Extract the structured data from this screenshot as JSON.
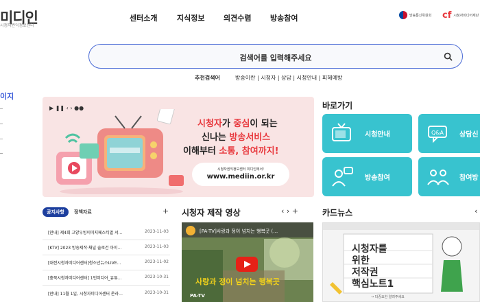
{
  "header": {
    "logo_text": "미디인",
    "logo_subtext": "시청자권익정보센터",
    "nav": [
      "센터소개",
      "지식정보",
      "의견수렴",
      "방송참여"
    ],
    "partners": [
      "방송통신위원회",
      "시청자미디어재단"
    ]
  },
  "search": {
    "placeholder": "검색어를 입력해주세요",
    "recommended_label": "추천검색어",
    "recommended": [
      "방송이란",
      "시청자",
      "상담",
      "시청안내",
      "피해예방"
    ]
  },
  "sidebar": {
    "title": "이지"
  },
  "banner": {
    "controls": "▶ ❚❚ ‹ › ●●",
    "line1_a": "시청자",
    "line1_b": "가 ",
    "line1_c": "중심",
    "line1_d": "이 되는",
    "line2_a": "신나는 ",
    "line2_b": "방송서비스",
    "line3_a": "이해부터 ",
    "line3_b": "소통, 참여까지!",
    "small": "시청자권익정보센터 미디인에서!",
    "url": "www.mediin.or.kr"
  },
  "quick": {
    "title": "바로가기",
    "tiles": [
      "시청안내",
      "상담신",
      "방송참여",
      "참여방"
    ]
  },
  "notices": {
    "tab_active": "공지사항",
    "tab_other": "정책자료",
    "more": "+",
    "items": [
      {
        "title": "[안내] 제4회 고양우빙이미지페스티벌 서…",
        "date": "2023-11-03"
      },
      {
        "title": "[KTV] 2023 방송제작·채널 솔로건 아이…",
        "date": "2023-11-03"
      },
      {
        "title": "[대전시청자미디어센터]청소년뉴스LIVE…",
        "date": "2023-11-02"
      },
      {
        "title": "[충북시청자미디어센터] 1인미디어_유튜…",
        "date": "2023-10-31"
      },
      {
        "title": "[안내] 11월 1일, 시청자미디어센터 온라…",
        "date": "2023-10-31"
      }
    ]
  },
  "video": {
    "title": "시청자 제작 영상",
    "arrows": "‹  ›  +",
    "caption": "[PA-TV]사랑과 정이 넘치는 행복곳 (…",
    "overlay": "사랑과 정이 넘치는 행복곳",
    "tag": "PA-TV"
  },
  "cardnews": {
    "title": "카드뉴스",
    "arrow": "‹",
    "handwriting_1": "시청자를",
    "handwriting_2": "위한",
    "handwriting_3": "저작권",
    "handwriting_4": "핵심노트1",
    "footer": "→ 더중요한 알려주세요"
  },
  "colors": {
    "accent": "#3a5bd9",
    "tile": "#38c3cf",
    "banner_bg": "#f9e4e4",
    "highlight": "#e8383d",
    "notice_tab": "#1d3f9e"
  }
}
